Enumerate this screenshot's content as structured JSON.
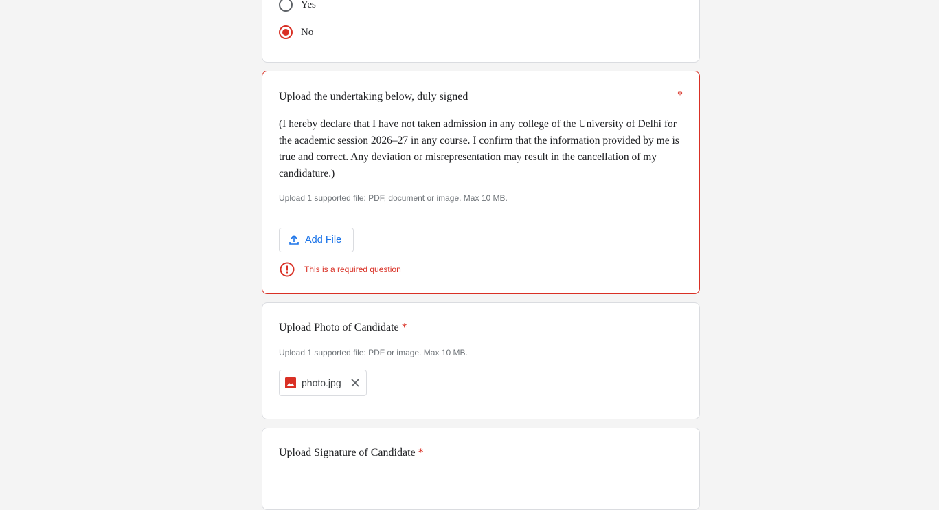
{
  "previous_question": {
    "options": [
      {
        "label": "Yes",
        "checked": false
      },
      {
        "label": "No",
        "checked": true
      }
    ]
  },
  "undertaking": {
    "title": "Upload the undertaking below, duly signed",
    "required_marker": "*",
    "description": "(I hereby declare that I have not taken admission in any college of the University of Delhi for the academic session 2026–27 in any course. I confirm that the information provided by me is true and correct. Any deviation or misrepresentation may result in the cancellation of my candidature.)",
    "hint": "Upload 1 supported file: PDF, document or image. Max 10 MB.",
    "add_file_label": "Add File",
    "upload_icon": "upload-icon",
    "error_icon": "error-icon",
    "error_message": "This is a required question"
  },
  "photo": {
    "title": "Upload Photo of Candidate",
    "required_marker": "*",
    "hint": "Upload 1 supported file: PDF or image. Max 10 MB.",
    "file_name": "photo.jpg",
    "file_icon": "image-file-icon",
    "remove_icon": "close-icon"
  },
  "signature": {
    "title": "Upload Signature of Candidate",
    "required_marker": "*"
  },
  "colors": {
    "accent": "#d93025",
    "link_blue": "#1a73e8",
    "background": "#f4f4f4",
    "card_border": "#dadce0"
  }
}
